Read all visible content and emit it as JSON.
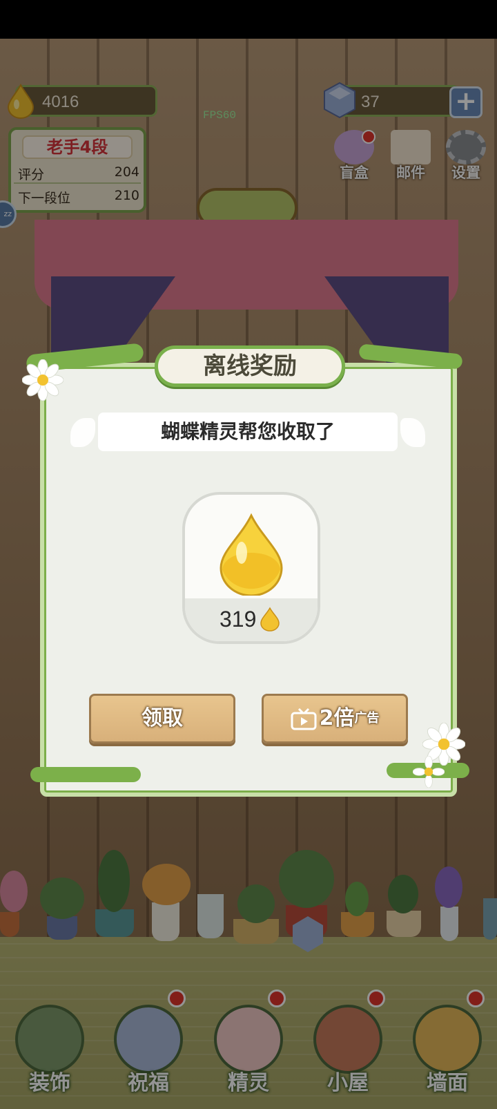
{
  "hud": {
    "coins": "4016",
    "gems": "37",
    "fps": "FPS60"
  },
  "rank": {
    "title": "老手4段",
    "score_label": "评分",
    "score_value": "204",
    "next_label": "下一段位",
    "next_value": "210"
  },
  "top_buttons": [
    {
      "label": "盲盒",
      "icon": "blind-box-icon"
    },
    {
      "label": "邮件",
      "icon": "mail-icon"
    },
    {
      "label": "设置",
      "icon": "gear-icon"
    }
  ],
  "side_chip": "zz",
  "dialog": {
    "title": "离线奖励",
    "subtitle": "蝴蝶精灵帮您收取了",
    "reward_amount": "319",
    "claim_label": "领取",
    "double_label": "2倍",
    "ad_tag": "广告"
  },
  "bottom_nav": [
    {
      "label": "装饰",
      "icon": "plant-pot-icon"
    },
    {
      "label": "祝福",
      "icon": "butterfly-icon"
    },
    {
      "label": "精灵",
      "icon": "fairy-icon"
    },
    {
      "label": "小屋",
      "icon": "house-icon"
    },
    {
      "label": "墙面",
      "icon": "bell-icon"
    }
  ],
  "colors": {
    "accent_green": "#7ab04c",
    "coin_gold": "#f2c230",
    "badge_red": "#e0342c",
    "wood_button": "#ddb682"
  }
}
